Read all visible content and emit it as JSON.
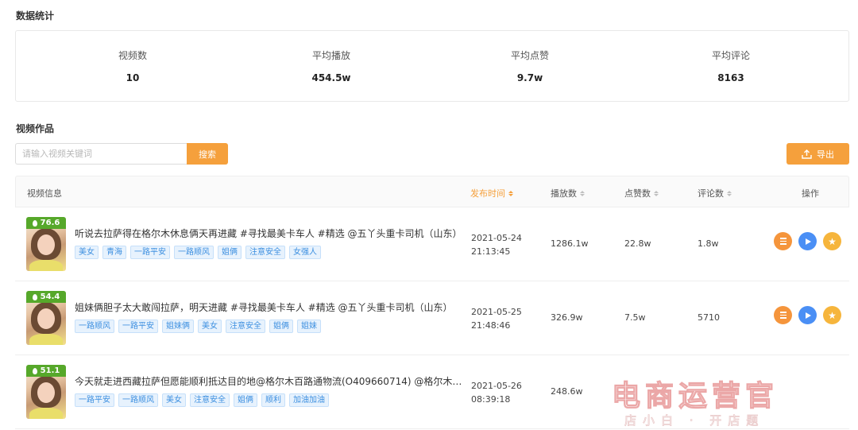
{
  "stats": {
    "title": "数据统计",
    "items": [
      {
        "label": "视频数",
        "value": "10"
      },
      {
        "label": "平均播放",
        "value": "454.5w"
      },
      {
        "label": "平均点赞",
        "value": "9.7w"
      },
      {
        "label": "平均评论",
        "value": "8163"
      }
    ]
  },
  "works": {
    "title": "视频作品",
    "search_placeholder": "请输入视频关键词",
    "search_value": "",
    "search_label": "搜索",
    "export_label": "导出"
  },
  "table": {
    "headers": {
      "info": "视频信息",
      "publish_time": "发布时间",
      "plays": "播放数",
      "likes": "点赞数",
      "comments": "评论数",
      "actions": "操作"
    },
    "rows": [
      {
        "score": "76.6",
        "title": "听说去拉萨得在格尔木休息俩天再进藏 #寻找最美卡车人 #精选 @五丫头重卡司机（山东）",
        "tags": [
          "美女",
          "青海",
          "一路平安",
          "一路顺风",
          "姐俩",
          "注意安全",
          "女强人"
        ],
        "date": "2021-05-24",
        "time": "21:13:45",
        "plays": "1286.1w",
        "likes": "22.8w",
        "comments": "1.8w"
      },
      {
        "score": "54.4",
        "title": "姐妹俩胆子太大敢闯拉萨，明天进藏 #寻找最美卡车人 #精选 @五丫头重卡司机（山东）",
        "tags": [
          "一路顺风",
          "一路平安",
          "姐妹俩",
          "美女",
          "注意安全",
          "姐俩",
          "姐妹"
        ],
        "date": "2021-05-25",
        "time": "21:48:46",
        "plays": "326.9w",
        "likes": "7.5w",
        "comments": "5710"
      },
      {
        "score": "51.1",
        "title": "今天就走进西藏拉萨但愿能顺利抵达目的地@格尔木百路通物流(O409660714) @格尔木川藏线",
        "tags": [
          "一路平安",
          "一路顺风",
          "美女",
          "注意安全",
          "姐俩",
          "顺利",
          "加油加油"
        ],
        "date": "2021-05-26",
        "time": "08:39:18",
        "plays": "248.6w",
        "likes": "",
        "comments": ""
      }
    ]
  },
  "watermark": {
    "text": "电商运营官",
    "subtext": "店小白 · 开店题"
  },
  "colors": {
    "accent": "#f5a03c",
    "tag_blue": "#3c8fe0",
    "score_green": "#56a82a",
    "play_blue": "#4a8ff5"
  }
}
